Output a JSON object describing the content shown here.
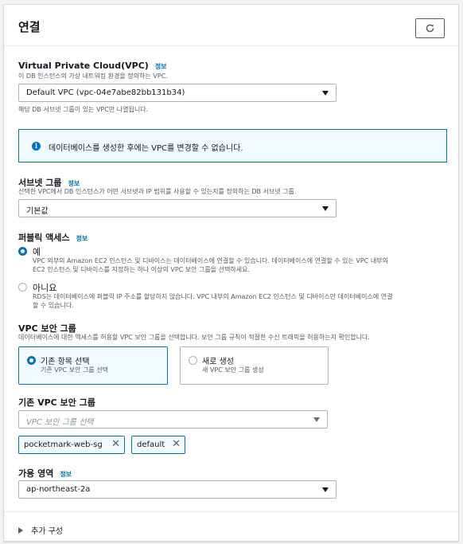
{
  "section": {
    "title": "연결"
  },
  "vpc": {
    "label": "Virtual Private Cloud(VPC)",
    "info": "정보",
    "description": "이 DB 인스턴스의 가상 네트워킹 환경을 정의하는 VPC.",
    "selected": "Default VPC (vpc-04e7abe82bb131b34)",
    "hint": "해당 DB 서브넷 그룹이 있는 VPC만 나열됩니다."
  },
  "alert": {
    "text": "데이터베이스를 생성한 후에는 VPC를 변경할 수 없습니다."
  },
  "subnet": {
    "label": "서브넷 그룹",
    "info": "정보",
    "description": "선택한 VPC에서 DB 인스턴스가 어떤 서브넷과 IP 범위를 사용할 수 있는지를 정의하는 DB 서브넷 그룹.",
    "selected": "기본값"
  },
  "public_access": {
    "label": "퍼블릭 액세스",
    "info": "정보",
    "options": [
      {
        "label": "예",
        "selected": true,
        "line1": "VPC 외부의 Amazon EC2 인스턴스 및 디바이스는 데이터베이스에 연결할 수 있습니다. 데이터베이스에 연결할 수 있는 VPC 내부의",
        "line2": "EC2 인스턴스 및 디바이스를 지정하는 하나 이상의 VPC 보안 그룹을 선택하세요."
      },
      {
        "label": "아니요",
        "selected": false,
        "line1": "RDS는 데이터베이스에 퍼블릭 IP 주소를 할당하지 않습니다. VPC 내부의 Amazon EC2 인스턴스 및 디바이스만 데이터베이스에 연결",
        "line2": "할 수 있습니다."
      }
    ]
  },
  "security_group": {
    "label": "VPC 보안 그룹",
    "description": "데이터베이스에 대한 액세스를 허용할 VPC 보안 그룹을 선택합니다. 보안 그룹 규칙이 적절한 수신 트래픽을 허용하는지 확인합니다.",
    "tiles": [
      {
        "title": "기존 항목 선택",
        "desc": "기존 VPC 보안 그룹 선택",
        "selected": true
      },
      {
        "title": "새로 생성",
        "desc": "새 VPC 보안 그룹 생성",
        "selected": false
      }
    ]
  },
  "existing_sg": {
    "label": "기존 VPC 보안 그룹",
    "placeholder": "VPC 보안 그룹 선택",
    "tokens": [
      "pocketmark-web-sg",
      "default"
    ],
    "remove_glyph": "✕"
  },
  "az": {
    "label": "가용 영역",
    "info": "정보",
    "selected": "ap-northeast-2a"
  },
  "additional": {
    "label": "추가 구성"
  },
  "icons": {
    "refresh": "refresh-icon",
    "info": "info-icon",
    "caret": "caret-down-icon",
    "expand": "caret-right-icon"
  },
  "colors": {
    "accent": "#0073bb",
    "text": "#16191f",
    "muted": "#545b64",
    "alert_bg": "#f1faff"
  }
}
